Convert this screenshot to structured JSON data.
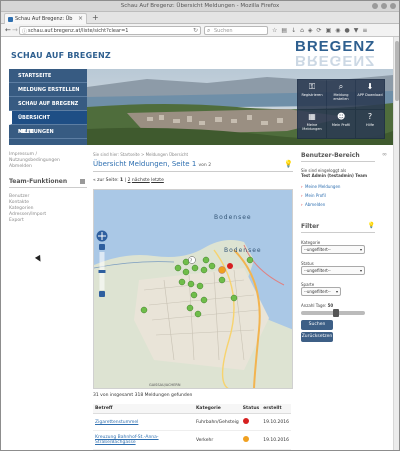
{
  "browser": {
    "title": "Schau Auf Bregenz: Übersicht Meldungen - Mozilla Firefox",
    "tab_label": "Schau Auf Bregenz: Üb",
    "url": "schau.auf.bregenz.at/liste/sicht?clear=1",
    "search_placeholder": "Suchen"
  },
  "site": {
    "brand": "SCHAU AUF BREGENZ",
    "logo": "BREGENZ",
    "nav": [
      "STARTSEITE",
      "MELDUNG ERSTELLEN",
      "SCHAU AUF BREGENZ",
      "ÜBERSICHT MELDUNGEN",
      "HILFE"
    ],
    "toolbox": [
      "Registrieren",
      "Meldung erstellen",
      "APP Download",
      "Meine Meldungen",
      "Mein Profil",
      "Hilfe"
    ]
  },
  "sidebar": {
    "links": [
      "Impressum /",
      "Nutzungsbedingungen",
      "Abmelden"
    ],
    "team_heading": "Team-Funktionen",
    "team_links": [
      "Benutzer",
      "Kontakte",
      "Kategorien",
      "Adressen/Import",
      "Export"
    ]
  },
  "main": {
    "breadcrumb": "Sie sind hier: Startseite > Meldungen Übersicht",
    "title": "Übersicht Meldungen, Seite 1",
    "title_of": "von 2",
    "pager": {
      "prev": "« zur Seite:",
      "current": "1",
      "next_page": "2",
      "next": "nächste",
      "last": "letzte"
    },
    "map_label_1": "Bodensee",
    "map_label_2": "Bodensee",
    "map_label_3": "GAISSAU/ACHERN",
    "count": "31 von insgesamt 318 Meldungen gefunden",
    "table": {
      "headers": [
        "Betreff",
        "Kategorie",
        "Status",
        "erstellt"
      ],
      "rows": [
        {
          "subject": "Zigarettenstummel",
          "category": "Fuhrbahn/Gehsteig",
          "status_color": "#d62020",
          "date": "19.10.2016"
        },
        {
          "subject": "Kreuzung Bahnhof-St.-Anna-Straße/Bachgasse",
          "category": "Verkehr",
          "status_color": "#f0a020",
          "date": "19.10.2016"
        }
      ]
    }
  },
  "right": {
    "heading": "Benutzer-Bereich",
    "logged_in_1": "Sie sind eingeloggt als",
    "logged_in_2": "Test Admin (testadmin) Team",
    "links": [
      "Meine Meldungen",
      "Mein Profil",
      "Abmelden"
    ],
    "filter_heading": "Filter",
    "filter": {
      "kategorie_label": "Kategorie",
      "kategorie_value": "--ungefiltert--",
      "status_label": "Status",
      "status_value": "--ungefiltert--",
      "sparte_label": "Sparte",
      "sparte_value": "--ungefiltert--",
      "anzahl_label": "Anzahl Tage:",
      "anzahl_value": "50",
      "search_button": "Suchen",
      "reset_button": "Zurücksetzen"
    }
  }
}
